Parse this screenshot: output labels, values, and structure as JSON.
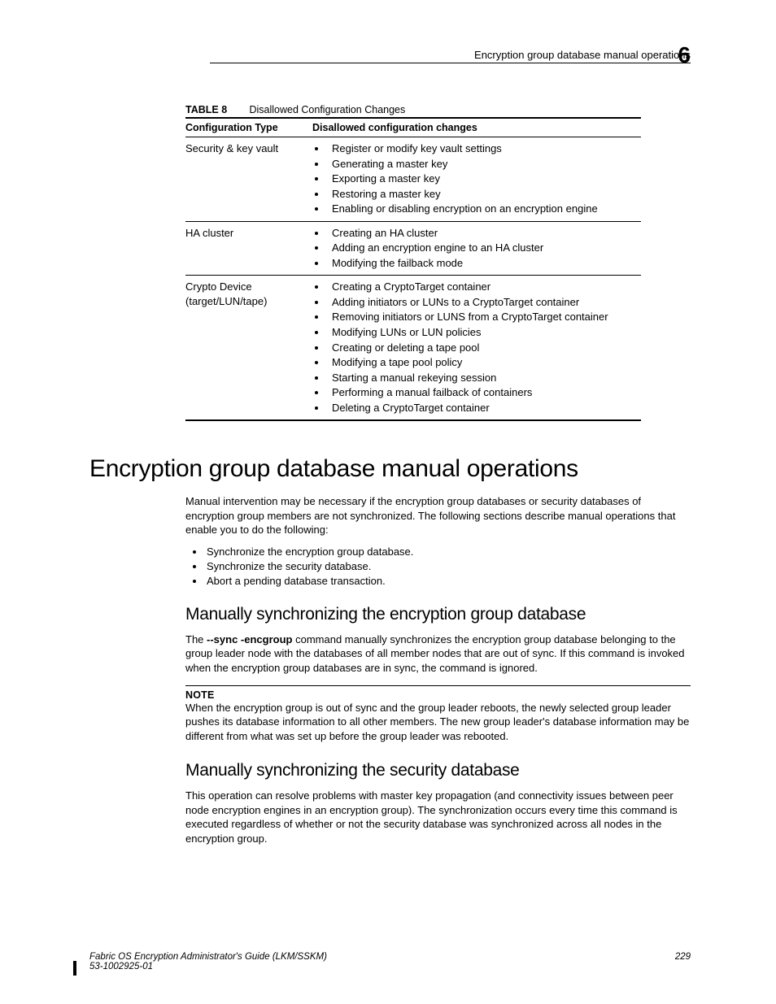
{
  "header": {
    "running_title": "Encryption group database manual operations",
    "chapter_number": "6"
  },
  "table": {
    "label": "TABLE 8",
    "title": "Disallowed Configuration Changes",
    "col1": "Configuration Type",
    "col2": "Disallowed configuration changes",
    "rows": [
      {
        "type": "Security & key vault",
        "items": [
          "Register or modify key vault settings",
          "Generating a master key",
          "Exporting a master key",
          "Restoring a master key",
          "Enabling or disabling encryption on an encryption engine"
        ]
      },
      {
        "type": "HA cluster",
        "items": [
          "Creating an HA cluster",
          "Adding an encryption engine to an HA cluster",
          "Modifying the failback mode"
        ]
      },
      {
        "type_line1": "Crypto Device",
        "type_line2": "(target/LUN/tape)",
        "items": [
          "Creating a CryptoTarget container",
          "Adding initiators or LUNs to a CryptoTarget container",
          "Removing initiators or LUNS from a CryptoTarget container",
          "Modifying LUNs or LUN policies",
          "Creating or deleting a tape pool",
          "Modifying a tape pool policy",
          "Starting a manual rekeying session",
          "Performing a manual failback of containers",
          "Deleting a CryptoTarget container"
        ]
      }
    ]
  },
  "h1": "Encryption group database manual operations",
  "intro": "Manual intervention may be necessary if the encryption group databases or security databases of encryption group members are not synchronized. The following sections describe manual operations that enable you to do the following:",
  "intro_bullets": [
    "Synchronize the encryption group database.",
    "Synchronize the security database.",
    "Abort a pending database transaction."
  ],
  "sec1": {
    "title": "Manually synchronizing the encryption group database",
    "pre": "The ",
    "cmd": "--sync -encgroup",
    "post": " command manually synchronizes the encryption group database belonging to the group leader node with the databases of all member nodes that are out of sync. If this command is invoked when the encryption group databases are in sync, the command is ignored.",
    "note_label": "NOTE",
    "note_text": "When the encryption group is out of sync and the group leader reboots, the newly selected group leader pushes its database information to all other members. The new group leader's database information may be different from what was set up before the group leader was rebooted."
  },
  "sec2": {
    "title": "Manually synchronizing the security database",
    "para": "This operation can resolve problems with master key propagation (and connectivity issues between peer node encryption engines in an encryption group). The synchronization occurs every time this command is executed regardless of whether or not the security database was synchronized across all nodes in the encryption group."
  },
  "footer": {
    "book": "Fabric OS Encryption Administrator's Guide  (LKM/SSKM)",
    "docnum": "53-1002925-01",
    "page": "229"
  }
}
